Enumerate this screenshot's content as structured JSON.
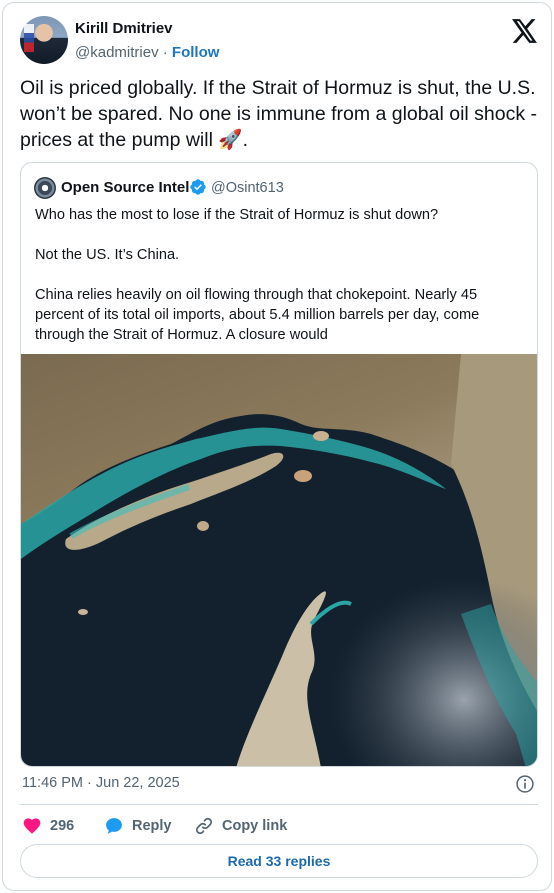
{
  "author": {
    "name": "Kirill Dmitriev",
    "handle": "@kadmitriev",
    "separator": "·",
    "follow_label": "Follow"
  },
  "tweet_text": "Oil is priced globally. If the Strait of Hormuz is shut, the U.S. won’t be spared. No one is immune from a global oil shock - prices at the pump will 🚀.",
  "quoted": {
    "name": "Open Source Intel",
    "handle": "@Osint613",
    "paragraphs": [
      "Who has the most to lose if the Strait of Hormuz is shut down?",
      "Not the US. It’s China.",
      "China relies heavily on oil flowing through that chokepoint. Nearly 45 percent of its total oil imports, about 5.4 million barrels per day, come through the Strait of Hormuz. A closure would"
    ]
  },
  "timestamp": "11:46 PM · Jun 22, 2025",
  "actions": {
    "like_count": "296",
    "reply_label": "Reply",
    "copy_label": "Copy link"
  },
  "read_replies_label": "Read 33 replies",
  "colors": {
    "like": "#f91880",
    "reply": "#1d9bf0",
    "link": "#1d69b0",
    "muted": "#536471",
    "border": "#cfd9de"
  }
}
